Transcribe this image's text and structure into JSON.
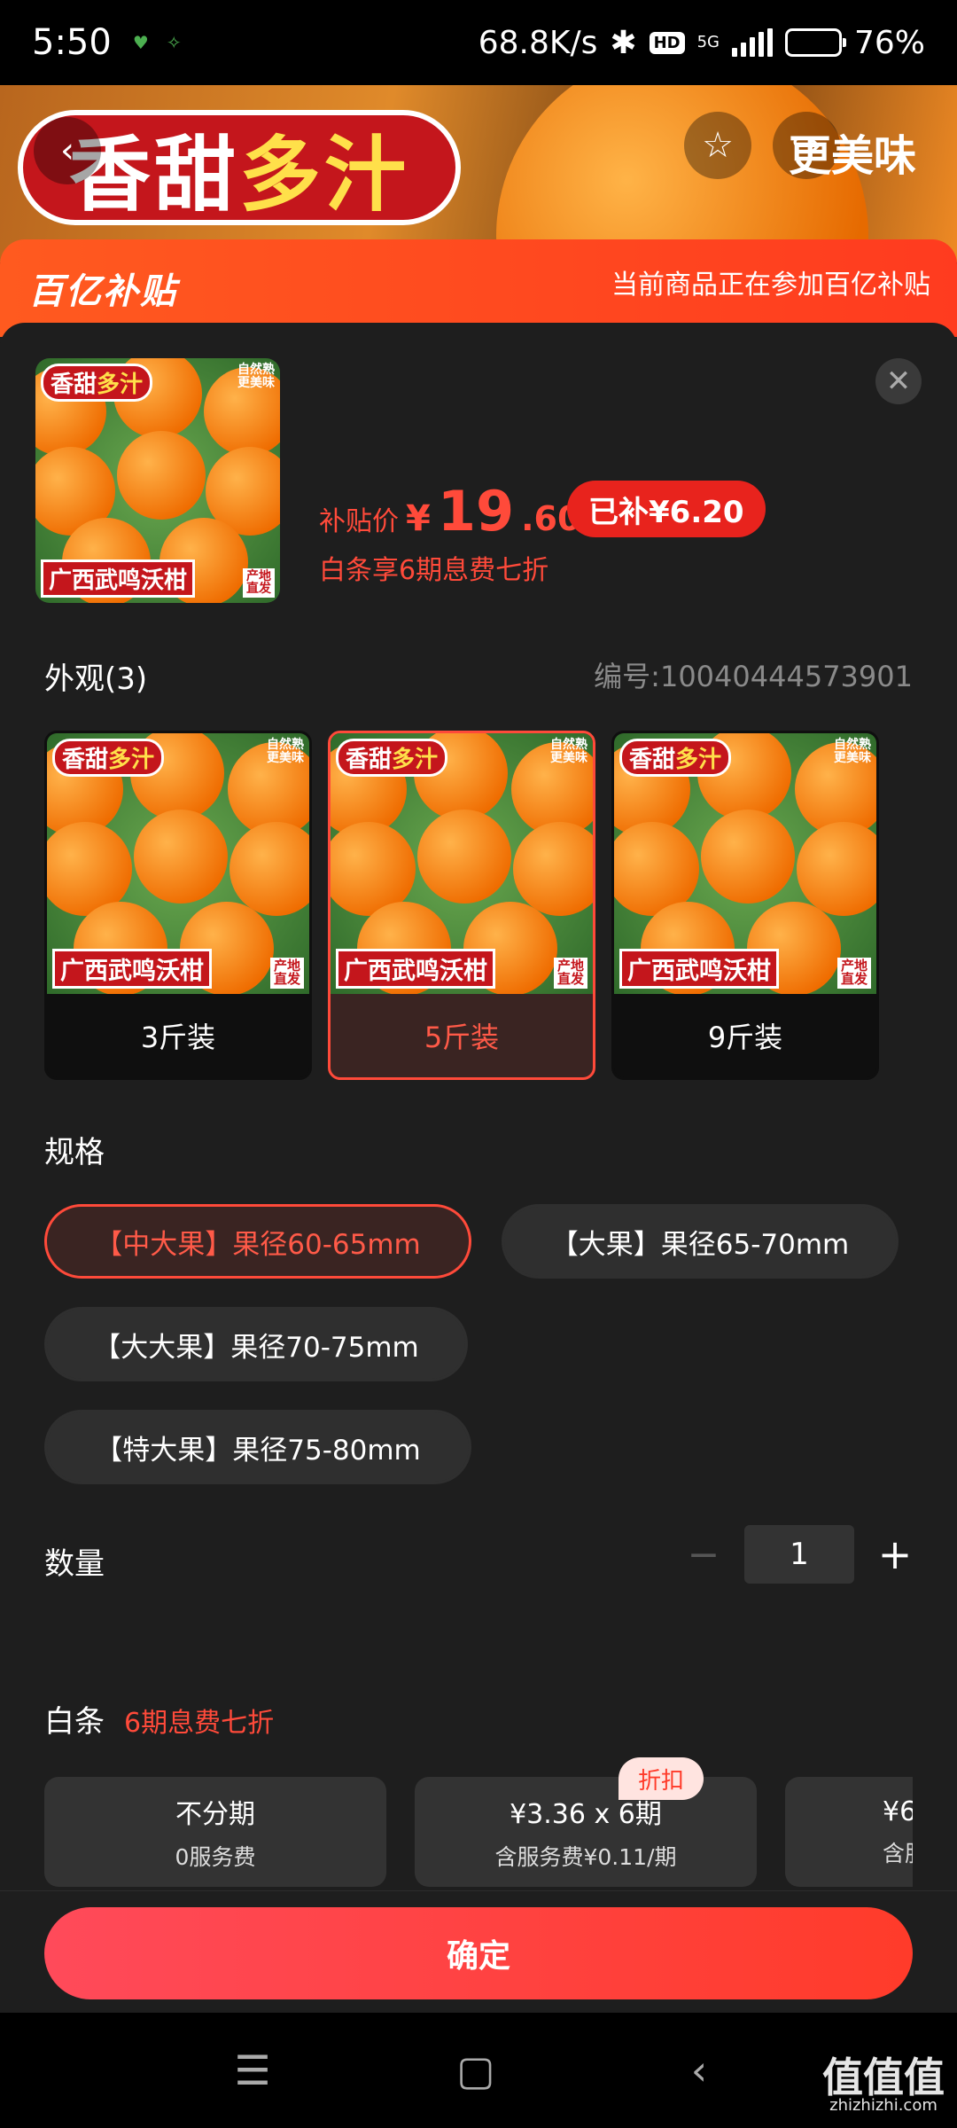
{
  "status_bar": {
    "time": "5:50",
    "net_speed": "68.8K/s",
    "hd": "HD",
    "network": "5G",
    "battery_level": 0.76,
    "battery_text": "76%"
  },
  "hero": {
    "banner_prefix": "香甜",
    "banner_highlight": "多汁",
    "corner_text": "更美味"
  },
  "subsidy": {
    "logo": "百亿补贴",
    "note": "当前商品正在参加百亿补贴"
  },
  "product": {
    "image_tag_prefix": "香甜",
    "image_tag_highlight": "多汁",
    "image_tag_nat_1": "自然熟",
    "image_tag_nat_2": "更美味",
    "image_name": "广西武鸣沃柑",
    "image_origin_1": "产地",
    "image_origin_2": "直发",
    "price_label": "补贴价",
    "price_currency": "¥",
    "price_int": "19",
    "price_dec": ".60",
    "subsidized": "已补¥6.20",
    "installment_note": "白条享6期息费七折"
  },
  "appearance": {
    "title": "外观(3)",
    "sku_id": "编号:10040444573901",
    "options": [
      {
        "label": "3斤装",
        "selected": false
      },
      {
        "label": "5斤装",
        "selected": true
      },
      {
        "label": "9斤装",
        "selected": false
      }
    ]
  },
  "spec": {
    "title": "规格",
    "options": [
      {
        "label": "【中大果】果径60-65mm",
        "selected": true
      },
      {
        "label": "【大果】果径65-70mm",
        "selected": false
      },
      {
        "label": "【大大果】果径70-75mm",
        "selected": false
      },
      {
        "label": "【特大果】果径75-80mm",
        "selected": false
      }
    ]
  },
  "quantity": {
    "title": "数量",
    "minus": "−",
    "value": "1",
    "plus": "+"
  },
  "baitiao": {
    "title": "白条",
    "subtitle": "6期息费七折",
    "plans": [
      {
        "title": "不分期",
        "sub": "0服务费"
      },
      {
        "title": "¥3.36 x 6期",
        "sub": "含服务费¥0.11/期",
        "badge": "折扣"
      },
      {
        "title": "¥6",
        "sub": "含服"
      }
    ]
  },
  "confirm_label": "确定",
  "watermark": {
    "main": "值值值",
    "sub": "zhizhizhi.com"
  },
  "colors": {
    "accent": "#ff4a3a",
    "sheet_bg": "#1e1e1e",
    "chip_bg": "#2f2f2f"
  }
}
